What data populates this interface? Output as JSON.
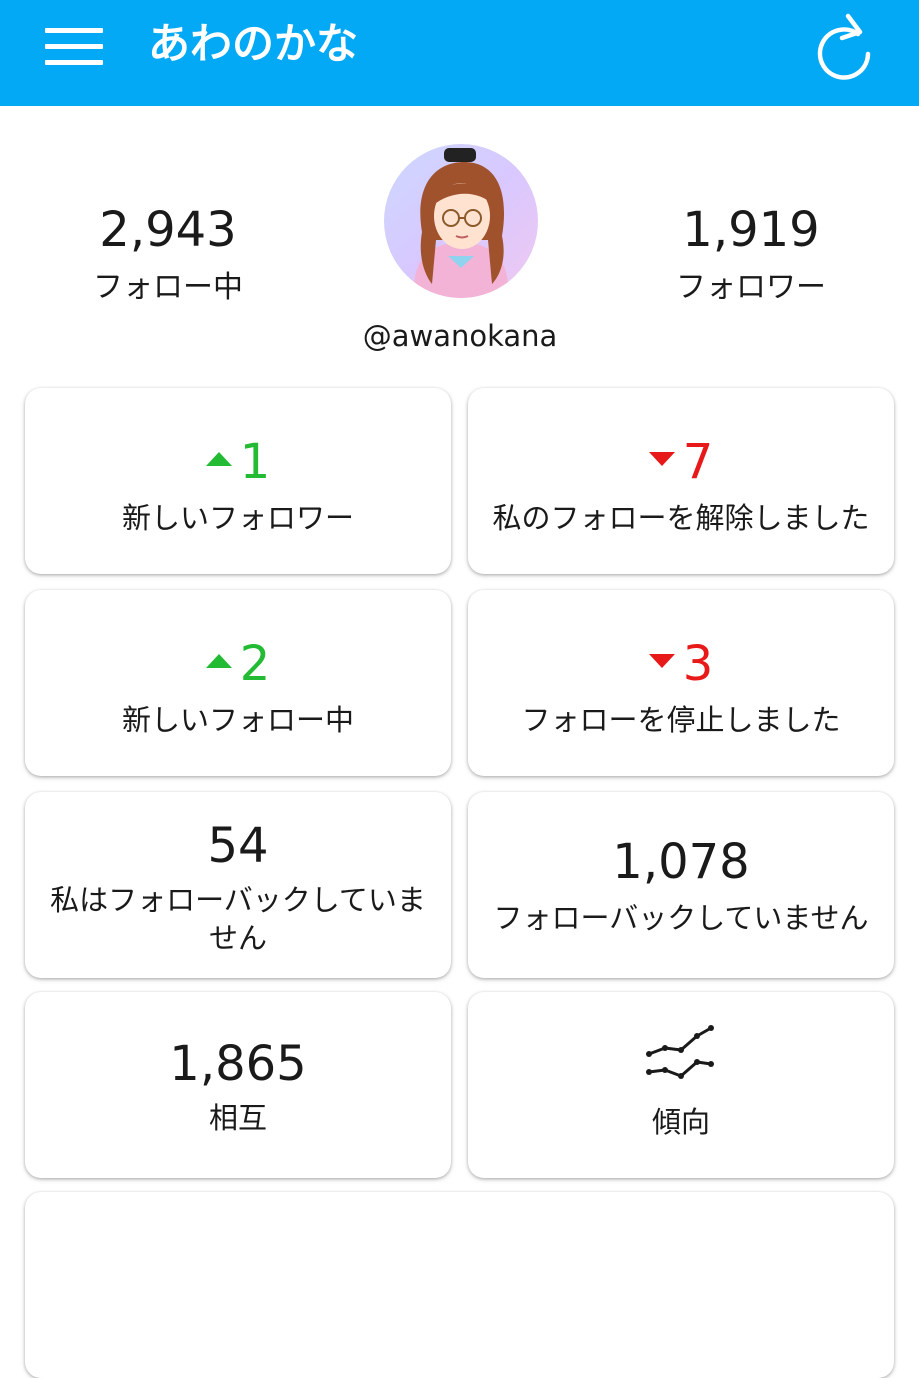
{
  "colors": {
    "appbar": "#03a9f4",
    "increase": "#22bb33",
    "decrease": "#e81919"
  },
  "app_bar": {
    "title": "あわのかな",
    "menu_icon": "hamburger-menu-icon",
    "refresh_icon": "refresh-icon"
  },
  "profile": {
    "following": {
      "count": "2,943",
      "label": "フォロー中"
    },
    "followers": {
      "count": "1,919",
      "label": "フォロワー"
    },
    "handle": "@awanokana"
  },
  "cards": {
    "new_followers": {
      "value": "1",
      "label": "新しいフォロワー",
      "trend": "up"
    },
    "unfollowed_me": {
      "value": "7",
      "label": "私のフォローを解除しました",
      "trend": "down"
    },
    "new_following": {
      "value": "2",
      "label": "新しいフォロー中",
      "trend": "up"
    },
    "stopped_following": {
      "value": "3",
      "label": "フォローを停止しました",
      "trend": "down"
    },
    "not_following_back_me": {
      "value": "54",
      "label_line1": "私はフォローバックしていま",
      "label_line2": "せん"
    },
    "not_following_back": {
      "value": "1,078",
      "label": "フォローバックしていません"
    },
    "mutual": {
      "value": "1,865",
      "label": "相互"
    },
    "trends": {
      "label": "傾向",
      "icon": "trend-chart-icon"
    }
  }
}
